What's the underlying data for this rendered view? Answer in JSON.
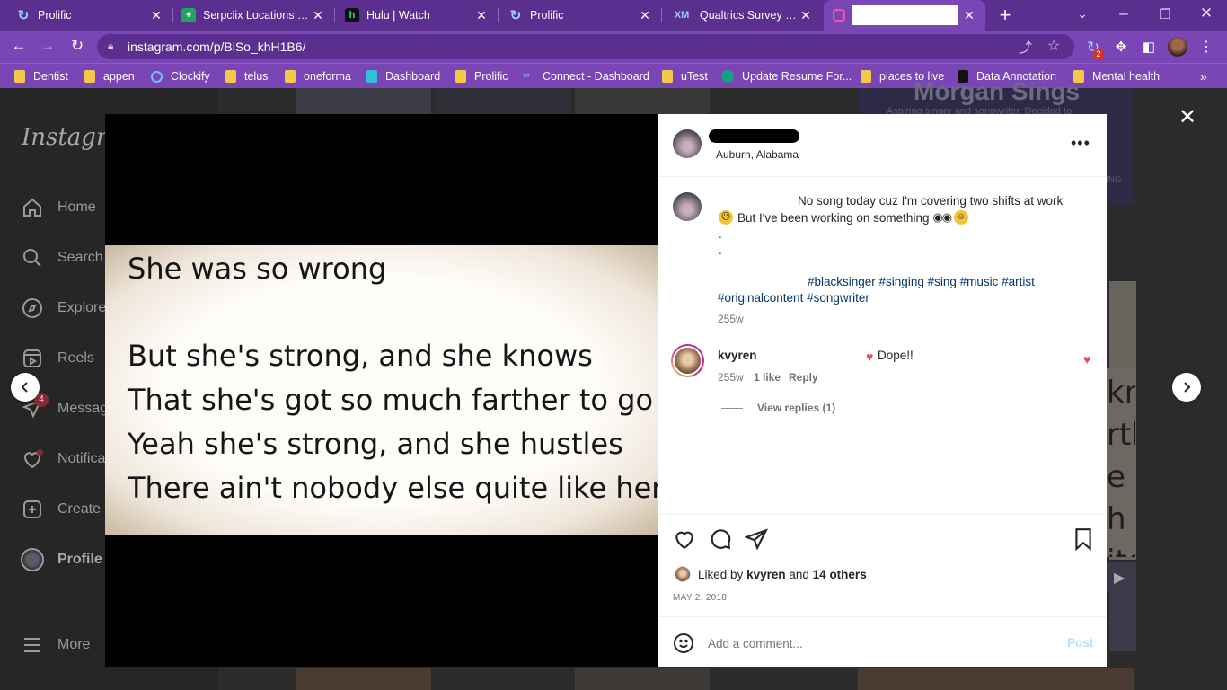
{
  "browser": {
    "tabs": [
      {
        "title": "Prolific",
        "icon": "prolific-icon"
      },
      {
        "title": "Serpclix Locations - Go",
        "icon": "sheets-icon"
      },
      {
        "title": "Hulu | Watch",
        "icon": "hulu-icon"
      },
      {
        "title": "Prolific",
        "icon": "prolific-icon"
      },
      {
        "title": "Qualtrics Survey | Qua",
        "icon": "qualtrics-icon"
      },
      {
        "title": "",
        "icon": "instagram-icon"
      }
    ],
    "url": "instagram.com/p/BiSo_khH1B6/",
    "bookmarks": [
      "Dentist",
      "appen",
      "Clockify",
      "telus",
      "oneforma",
      "Dashboard",
      "Prolific",
      "Connect - Dashboard",
      "uTest",
      "Update Resume For...",
      "places to live",
      "Data Annotation",
      "Mental health"
    ],
    "badge_count": "2"
  },
  "sidebar": {
    "logo": "Instagram",
    "items": [
      "Home",
      "Search",
      "Explore",
      "Reels",
      "Messages",
      "Notifications",
      "Create",
      "Profile",
      "More"
    ],
    "messages_badge": "4"
  },
  "background": {
    "profile_title": "Morgan Sings",
    "profile_subtitle": "Aspiring singer and songwriter. Decided to",
    "peek_fragment": "ING"
  },
  "post": {
    "lyrics": [
      "She was so wrong",
      "But she's strong, and she knows",
      "That she's got so much farther to go",
      "Yeah she's strong, and she hustles",
      "There ain't nobody else quite like her"
    ],
    "location": "Auburn, Alabama",
    "caption_line1": "No song today cuz I'm covering two shifts at work",
    "caption_line2": "But I've been working on something",
    "caption_dot1": ".",
    "caption_dot2": ".",
    "hashtags_line1": "#blacksinger #singing #sing #music #artist",
    "hashtags_line2": "#originalcontent #songwriter",
    "caption_time": "255w",
    "comment": {
      "user": "kvyren",
      "text": "Dope!!",
      "time": "255w",
      "likes": "1 like",
      "reply": "Reply",
      "view_replies": "View replies (1)"
    },
    "liked_by_prefix": "Liked by",
    "liked_by_user": "kvyren",
    "liked_by_and": "and",
    "liked_by_others": "14 others",
    "date": "MAY 2, 2018",
    "comment_placeholder": "Add a comment...",
    "post_button": "Post"
  },
  "colors": {
    "browser_dark": "#5b2f8f",
    "browser_mid": "#7a45b5",
    "instagram_link": "#00376b",
    "post_button": "#b2dffc",
    "heart_red": "#ed4956"
  }
}
